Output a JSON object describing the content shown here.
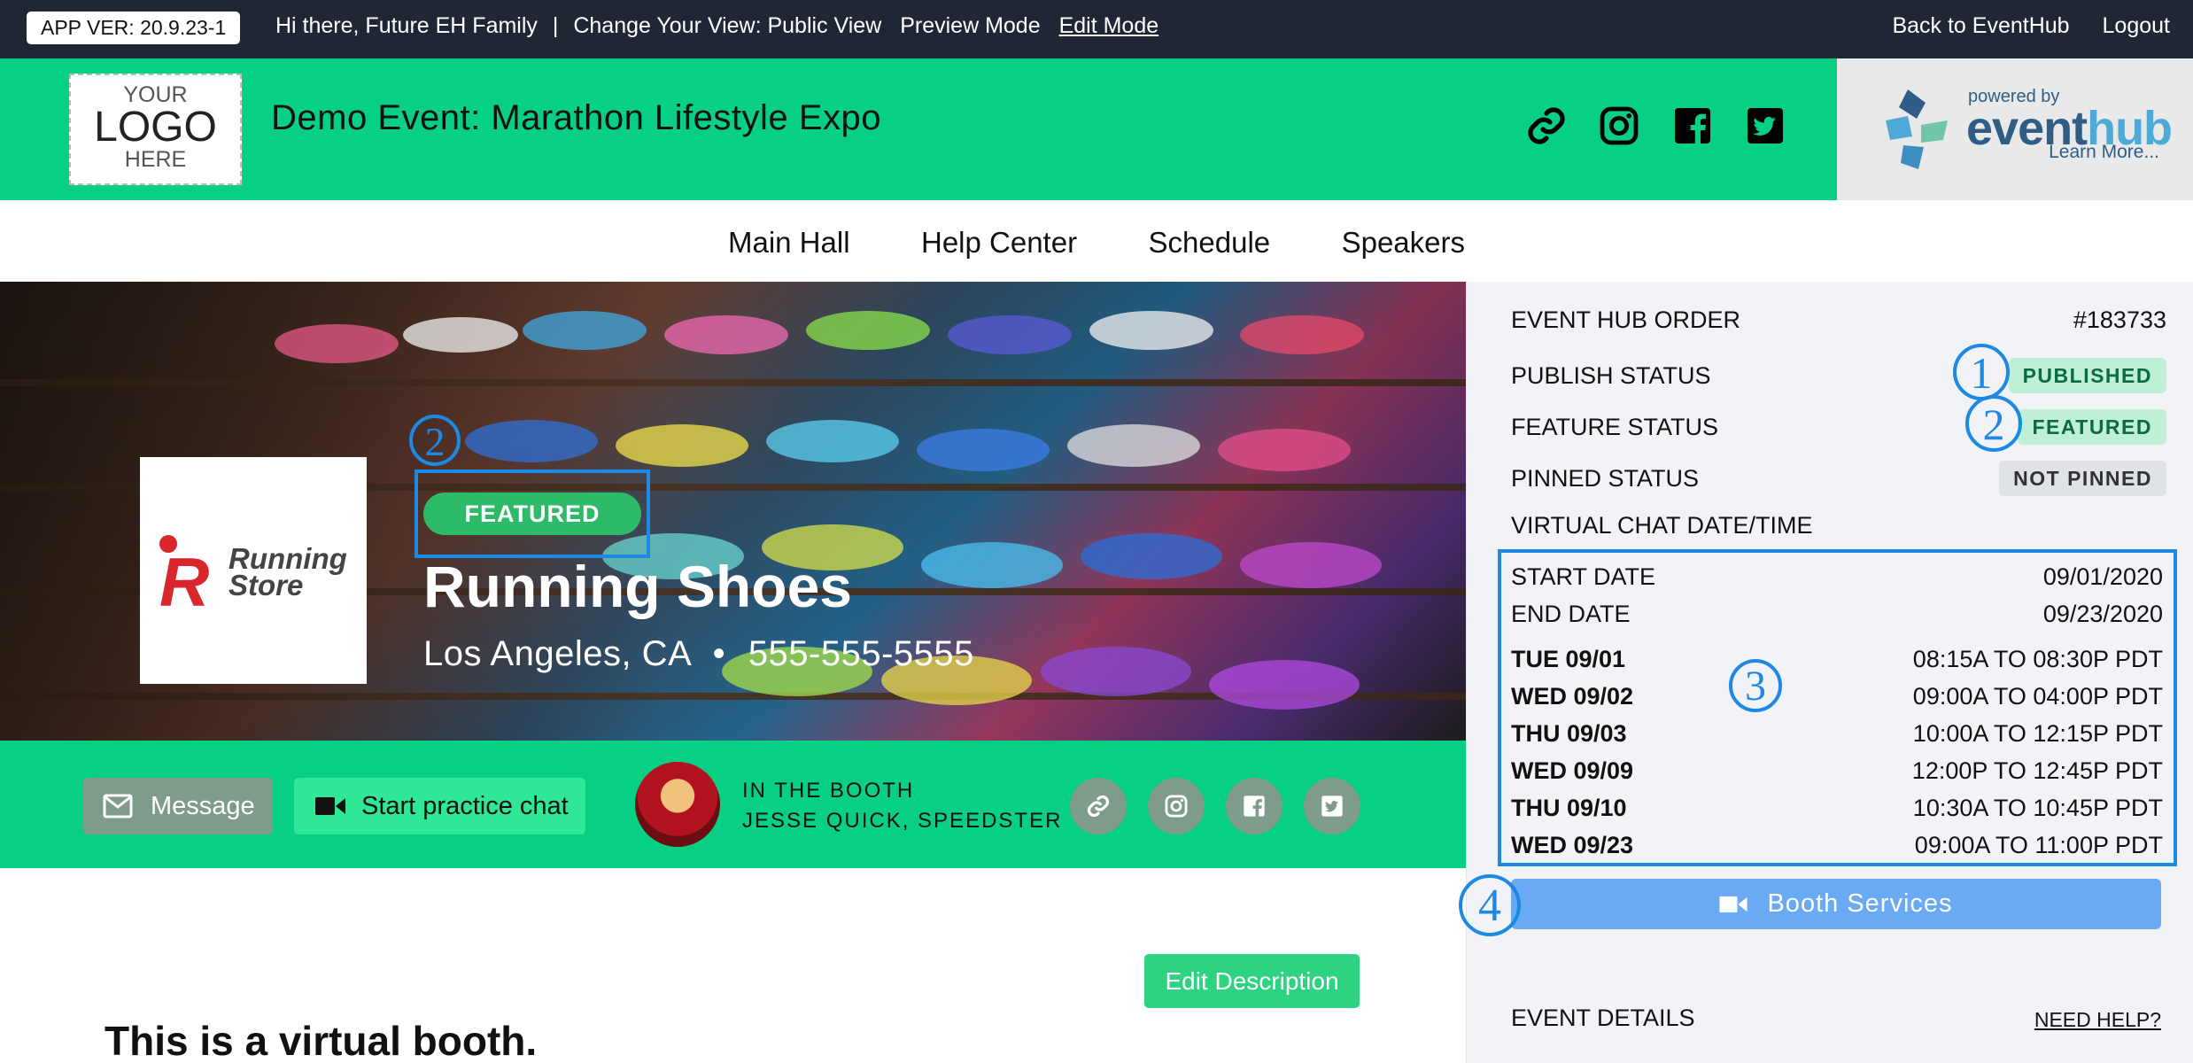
{
  "topbar": {
    "version": "APP VER: 20.9.23-1",
    "greeting": "Hi there, Future EH Family",
    "separator": "|",
    "change_view": "Change Your View: Public View",
    "preview_mode": "Preview Mode",
    "edit_mode": "Edit Mode",
    "back": "Back to EventHub",
    "logout": "Logout"
  },
  "header": {
    "logo": {
      "line1": "YOUR",
      "line2": "LOGO",
      "line3": "HERE"
    },
    "title": "Demo Event: Marathon Lifestyle Expo",
    "icons": [
      "link-icon",
      "instagram-icon",
      "facebook-icon",
      "twitter-icon"
    ],
    "powered_by": "powered by",
    "brand_event": "event",
    "brand_hub": "hub",
    "learn_more": "Learn More..."
  },
  "nav": {
    "items": [
      "Main Hall",
      "Help Center",
      "Schedule",
      "Speakers"
    ]
  },
  "hero": {
    "company_logo_text": [
      "Running",
      "Store"
    ],
    "company_logo_letter": "R",
    "featured_badge": "FEATURED",
    "booth_name": "Running Shoes",
    "location": "Los Angeles, CA",
    "bullet": "•",
    "phone": "555-555-5555"
  },
  "actions": {
    "message": "Message",
    "practice_chat": "Start practice chat",
    "in_booth_label": "IN THE BOOTH",
    "in_booth_person": "JESSE QUICK, SPEEDSTER"
  },
  "main": {
    "edit_description": "Edit Description",
    "heading": "This is a virtual booth."
  },
  "sidebar": {
    "order_label": "EVENT HUB ORDER",
    "order_value": "#183733",
    "publish_label": "PUBLISH STATUS",
    "publish_value": "PUBLISHED",
    "feature_label": "FEATURE STATUS",
    "feature_value": "FEATURED",
    "pinned_label": "PINNED STATUS",
    "pinned_value": "NOT PINNED",
    "chat_label": "VIRTUAL CHAT DATE/TIME",
    "start_label": "START DATE",
    "start_value": "09/01/2020",
    "end_label": "END DATE",
    "end_value": "09/23/2020",
    "schedule": [
      {
        "day": "TUE 09/01",
        "time": "08:15A TO 08:30P PDT"
      },
      {
        "day": "WED 09/02",
        "time": "09:00A TO 04:00P PDT"
      },
      {
        "day": "THU 09/03",
        "time": "10:00A TO 12:15P PDT"
      },
      {
        "day": "WED 09/09",
        "time": "12:00P TO 12:45P PDT"
      },
      {
        "day": "THU 09/10",
        "time": "10:30A TO 10:45P PDT"
      },
      {
        "day": "WED 09/23",
        "time": "09:00A TO 11:00P PDT"
      }
    ],
    "booth_services": "Booth Services",
    "event_details": "EVENT DETAILS",
    "need_help": "NEED HELP?"
  },
  "annotations": [
    "1",
    "2",
    "2",
    "3",
    "4"
  ],
  "colors": {
    "topbar": "#1f2735",
    "brand_green": "#07cf83",
    "featured_green": "#2dba69",
    "annotation_blue": "#1e88e5",
    "booth_services_blue": "#6aa9f3"
  }
}
